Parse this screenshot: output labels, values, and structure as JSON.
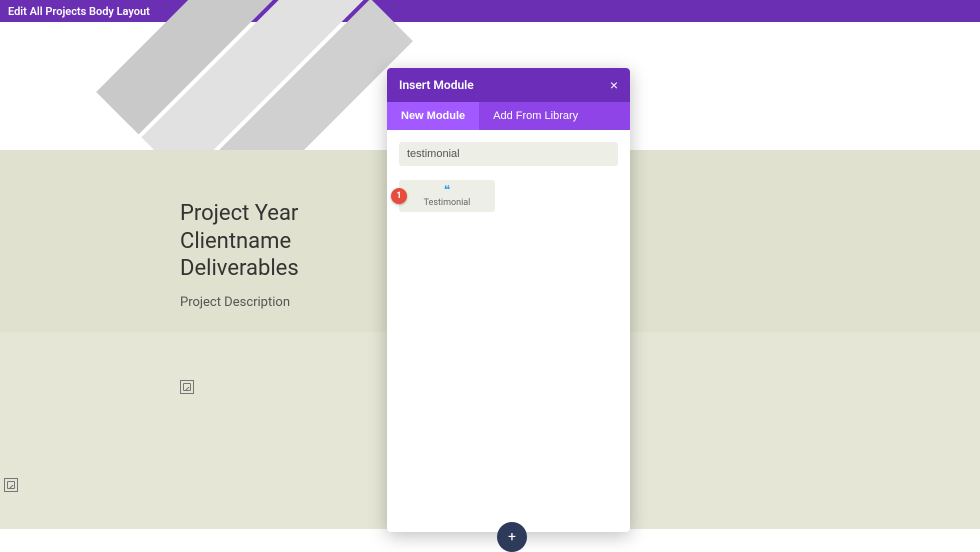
{
  "topbar": {
    "title": "Edit All Projects Body Layout"
  },
  "hero": {
    "line1": "Project Year",
    "line2": "Clientname",
    "line3": "Deliverables",
    "description": "Project Description"
  },
  "modal": {
    "title": "Insert Module",
    "close_symbol": "×",
    "tabs": {
      "new": "New Module",
      "library": "Add From Library"
    },
    "search_value": "testimonial",
    "module": {
      "label": "Testimonial",
      "badge": "1",
      "icon_glyph": "❝"
    }
  },
  "fab": {
    "glyph": "+"
  }
}
